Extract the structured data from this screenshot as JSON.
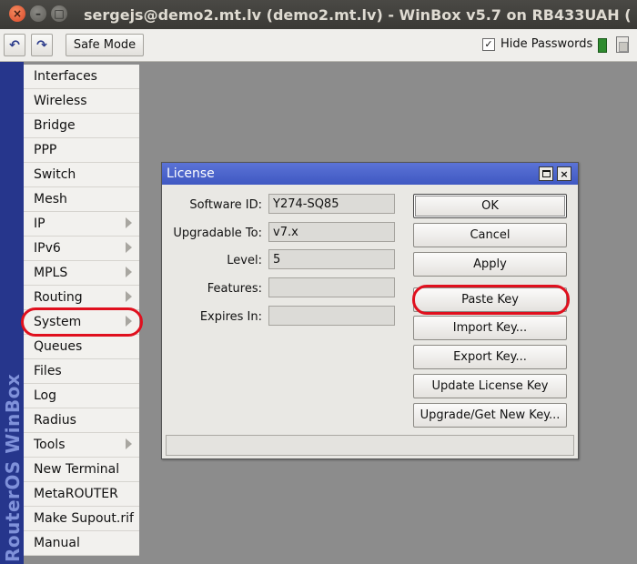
{
  "window": {
    "title": "sergejs@demo2.mt.lv (demo2.mt.lv) - WinBox v5.7 on RB433UAH (",
    "close_glyph": "×",
    "minimize_glyph": "–",
    "maximize_glyph": "□"
  },
  "toolbar": {
    "undo_glyph": "↶",
    "redo_glyph": "↷",
    "safe_mode_label": "Safe Mode",
    "hide_passwords_label": "Hide Passwords",
    "hide_passwords_checked": true,
    "check_glyph": "✓"
  },
  "sidebar": {
    "brand": "RouterOS WinBox",
    "items": [
      {
        "label": "Interfaces",
        "submenu": false
      },
      {
        "label": "Wireless",
        "submenu": false
      },
      {
        "label": "Bridge",
        "submenu": false
      },
      {
        "label": "PPP",
        "submenu": false
      },
      {
        "label": "Switch",
        "submenu": false
      },
      {
        "label": "Mesh",
        "submenu": false
      },
      {
        "label": "IP",
        "submenu": true
      },
      {
        "label": "IPv6",
        "submenu": true
      },
      {
        "label": "MPLS",
        "submenu": true
      },
      {
        "label": "Routing",
        "submenu": true
      },
      {
        "label": "System",
        "submenu": true
      },
      {
        "label": "Queues",
        "submenu": false
      },
      {
        "label": "Files",
        "submenu": false
      },
      {
        "label": "Log",
        "submenu": false
      },
      {
        "label": "Radius",
        "submenu": false
      },
      {
        "label": "Tools",
        "submenu": true
      },
      {
        "label": "New Terminal",
        "submenu": false
      },
      {
        "label": "MetaROUTER",
        "submenu": false
      },
      {
        "label": "Make Supout.rif",
        "submenu": false
      },
      {
        "label": "Manual",
        "submenu": false
      }
    ]
  },
  "dialog": {
    "title": "License",
    "maximize_glyph": "",
    "close_glyph": "×",
    "fields": [
      {
        "label": "Software ID:",
        "value": "Y274-SQ85"
      },
      {
        "label": "Upgradable To:",
        "value": "v7.x"
      },
      {
        "label": "Level:",
        "value": "5"
      },
      {
        "label": "Features:",
        "value": ""
      },
      {
        "label": "Expires In:",
        "value": ""
      }
    ],
    "buttons": {
      "ok": "OK",
      "cancel": "Cancel",
      "apply": "Apply",
      "paste_key": "Paste Key",
      "import_key": "Import Key...",
      "export_key": "Export Key...",
      "update_license_key": "Update License Key",
      "upgrade_get_new_key": "Upgrade/Get New Key..."
    },
    "status": ""
  }
}
